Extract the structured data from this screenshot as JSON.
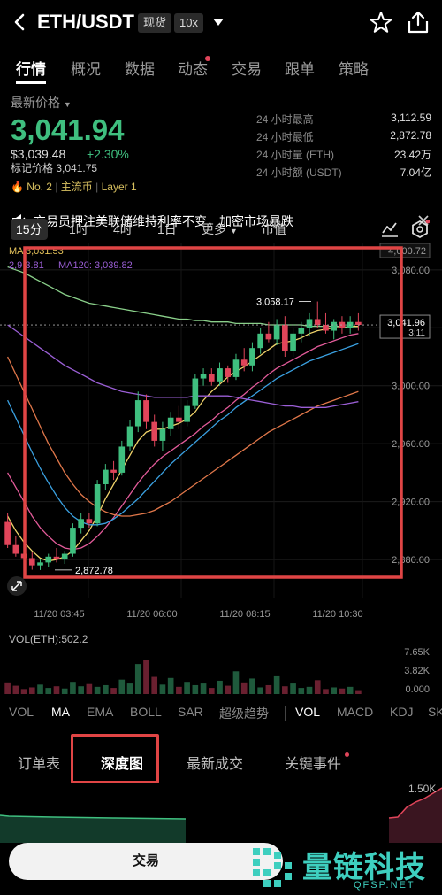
{
  "header": {
    "pair": "ETH/USDT",
    "badge_spot": "现货",
    "badge_leverage": "10x"
  },
  "tabs": [
    "行情",
    "概况",
    "数据",
    "动态",
    "交易",
    "跟单",
    "策略"
  ],
  "price": {
    "label": "最新价格",
    "last": "3,041.94",
    "usd": "$3,039.48",
    "change": "+2.30%",
    "mark": "标记价格 3,041.75",
    "rank": "No. 2",
    "category1": "主流币",
    "category2": "Layer 1"
  },
  "stats": [
    {
      "label": "24 小时最高",
      "value": "3,112.59"
    },
    {
      "label": "24 小时最低",
      "value": "2,872.78"
    },
    {
      "label": "24 小时量 (ETH)",
      "value": "23.42万"
    },
    {
      "label": "24 小时额 (USDT)",
      "value": "7.04亿"
    }
  ],
  "news": {
    "text": "交易员押注美联储维持利率不变，加密市场暴跌"
  },
  "intervals": {
    "items": [
      "15分",
      "1时",
      "4时",
      "1日",
      "更多",
      "市值"
    ]
  },
  "chart_data": {
    "type": "candlestick",
    "ma_legend": {
      "ma_top": "MA",
      "ma_top_values": "3,031.53",
      "ma120_label": "MA120: 3,039.82",
      "ma_prefix": "2,9",
      "ma_prefix_tail": "3.81"
    },
    "x_tick_labels": [
      "11/20 03:45",
      "11/20 06:00",
      "11/20 08:15",
      "11/20 10:30"
    ],
    "y_tick_labels": [
      "3,080.00",
      "3,040.00",
      "3,000.00",
      "2,960.00",
      "2,920.00",
      "2,880.00"
    ],
    "ylim": [
      2866,
      3086
    ],
    "y_ticks": [
      3080,
      3040,
      3000,
      2960,
      2920,
      2880
    ],
    "price_tag_top": "4,000.72",
    "current_price_tag": "3,041.96",
    "countdown": "3:11",
    "current_price": 3041.96,
    "high_marker": "3,058.17",
    "low_marker": "2,872.78",
    "candles": [
      [
        2906,
        2912,
        2888,
        2890
      ],
      [
        2890,
        2896,
        2882,
        2884
      ],
      [
        2884,
        2888,
        2878,
        2881
      ],
      [
        2881,
        2885,
        2873,
        2876
      ],
      [
        2876,
        2880,
        2872.78,
        2878
      ],
      [
        2878,
        2884,
        2875,
        2882
      ],
      [
        2882,
        2888,
        2878,
        2880
      ],
      [
        2880,
        2886,
        2877,
        2884
      ],
      [
        2884,
        2905,
        2882,
        2902
      ],
      [
        2902,
        2912,
        2898,
        2908
      ],
      [
        2908,
        2912,
        2902,
        2905
      ],
      [
        2905,
        2935,
        2903,
        2932
      ],
      [
        2932,
        2946,
        2928,
        2942
      ],
      [
        2942,
        2948,
        2935,
        2940
      ],
      [
        2940,
        2962,
        2938,
        2958
      ],
      [
        2958,
        2976,
        2955,
        2972
      ],
      [
        2972,
        2996,
        2968,
        2990
      ],
      [
        2990,
        2994,
        2970,
        2975
      ],
      [
        2975,
        2980,
        2958,
        2962
      ],
      [
        2962,
        2975,
        2955,
        2970
      ],
      [
        2970,
        2982,
        2965,
        2978
      ],
      [
        2978,
        2986,
        2970,
        2975
      ],
      [
        2975,
        2990,
        2972,
        2986
      ],
      [
        2986,
        3008,
        2984,
        3005
      ],
      [
        3005,
        3012,
        3000,
        3008
      ],
      [
        3008,
        3012,
        3000,
        3003
      ],
      [
        3003,
        3016,
        3000,
        3012
      ],
      [
        3012,
        3014,
        3002,
        3006
      ],
      [
        3006,
        3022,
        3004,
        3018
      ],
      [
        3018,
        3026,
        3010,
        3014
      ],
      [
        3014,
        3030,
        3010,
        3026
      ],
      [
        3026,
        3040,
        3022,
        3036
      ],
      [
        3036,
        3044,
        3030,
        3032
      ],
      [
        3032,
        3046,
        3028,
        3042
      ],
      [
        3042,
        3048,
        3020,
        3024
      ],
      [
        3024,
        3040,
        3020,
        3036
      ],
      [
        3036,
        3044,
        3030,
        3040
      ],
      [
        3040,
        3050,
        3034,
        3046
      ],
      [
        3046,
        3058.17,
        3040,
        3042
      ],
      [
        3042,
        3050,
        3036,
        3038
      ],
      [
        3038,
        3046,
        3032,
        3044
      ],
      [
        3044,
        3048,
        3036,
        3040
      ],
      [
        3040,
        3048,
        3036,
        3044
      ],
      [
        3044,
        3050,
        3038,
        3042
      ]
    ],
    "ma_lines": [
      {
        "color": "#f0d36a",
        "values": [
          2910,
          2900,
          2892,
          2886,
          2881,
          2879,
          2880,
          2882,
          2886,
          2893,
          2900,
          2910,
          2922,
          2932,
          2942,
          2952,
          2962,
          2968,
          2970,
          2970,
          2972,
          2974,
          2977,
          2982,
          2990,
          2996,
          3001,
          3006,
          3010,
          3013,
          3017,
          3021,
          3025,
          3029,
          3030,
          3031,
          3033,
          3036,
          3038,
          3039,
          3040,
          3040,
          3041,
          3041
        ]
      },
      {
        "color": "#e35b9a",
        "values": [
          2940,
          2930,
          2920,
          2910,
          2902,
          2896,
          2891,
          2888,
          2887,
          2888,
          2891,
          2896,
          2902,
          2909,
          2917,
          2925,
          2933,
          2940,
          2946,
          2951,
          2955,
          2959,
          2963,
          2967,
          2972,
          2976,
          2981,
          2985,
          2990,
          2994,
          2999,
          3003,
          3008,
          3012,
          3015,
          3018,
          3021,
          3024,
          3027,
          3029,
          3031,
          3033,
          3035,
          3036
        ]
      },
      {
        "color": "#3aa0e0",
        "values": [
          2990,
          2978,
          2966,
          2954,
          2943,
          2933,
          2924,
          2916,
          2910,
          2906,
          2904,
          2904,
          2905,
          2908,
          2912,
          2917,
          2922,
          2928,
          2934,
          2940,
          2946,
          2951,
          2956,
          2961,
          2966,
          2971,
          2976,
          2980,
          2985,
          2989,
          2993,
          2997,
          3001,
          3005,
          3008,
          3011,
          3014,
          3017,
          3019,
          3021,
          3023,
          3025,
          3027,
          3029
        ]
      },
      {
        "color": "#e0774a",
        "values": [
          3020,
          3008,
          2996,
          2984,
          2972,
          2960,
          2950,
          2940,
          2932,
          2925,
          2920,
          2916,
          2913,
          2911,
          2910,
          2910,
          2911,
          2912,
          2914,
          2917,
          2920,
          2924,
          2928,
          2932,
          2936,
          2940,
          2944,
          2948,
          2952,
          2956,
          2960,
          2964,
          2968,
          2971,
          2974,
          2977,
          2980,
          2983,
          2986,
          2988,
          2990,
          2992,
          2994,
          2996
        ]
      },
      {
        "color": "#9b5fd6",
        "values": [
          3042,
          3038,
          3034,
          3030,
          3026,
          3022,
          3018,
          3014,
          3011,
          3008,
          3005,
          3002,
          3000,
          2998,
          2996,
          2995,
          2994,
          2993,
          2992,
          2992,
          2992,
          2992,
          2992,
          2993,
          2993,
          2993,
          2993,
          2993,
          2992,
          2991,
          2990,
          2989,
          2988,
          2987,
          2986,
          2986,
          2985,
          2985,
          2985,
          2985,
          2986,
          2987,
          2988,
          2989
        ]
      },
      {
        "color": "#8ad08a",
        "values": [
          3082,
          3080,
          3078,
          3075,
          3072,
          3069,
          3066,
          3063,
          3061,
          3059,
          3057,
          3056,
          3055,
          3054,
          3053,
          3052,
          3051,
          3050,
          3049,
          3048,
          3047,
          3046,
          3046,
          3045,
          3045,
          3044,
          3044,
          3044,
          3043,
          3043,
          3043,
          3043,
          3042,
          3042,
          3042,
          3042,
          3042,
          3041,
          3041,
          3041,
          3041,
          3041,
          3040,
          3040
        ]
      }
    ],
    "volume_label": "VOL(ETH):502.2",
    "volume_ticks": [
      "7.65K",
      "3.82K",
      "0.000"
    ],
    "volume_max": 7650,
    "volume": [
      2100,
      1500,
      900,
      1200,
      1700,
      1100,
      1400,
      1000,
      2200,
      1400,
      1800,
      1300,
      1600,
      1100,
      2600,
      1900,
      5400,
      6200,
      3100,
      1700,
      2900,
      1300,
      2200,
      1600,
      1900,
      1100,
      2400,
      1500,
      4100,
      2100,
      2800,
      1200,
      1600,
      3200,
      1400,
      1900,
      1100,
      1300,
      2500,
      900,
      1200,
      1000,
      1300,
      700
    ]
  },
  "indicators": {
    "main": [
      "VOL",
      "MA",
      "EMA",
      "BOLL",
      "SAR",
      "超级趋势"
    ],
    "sub": [
      "VOL",
      "MACD",
      "KDJ",
      "SK"
    ]
  },
  "subtabs": [
    "订单表",
    "深度图",
    "最新成交",
    "关键事件"
  ],
  "depth": {
    "label": "1.50K"
  },
  "trade": {
    "button": "交易"
  },
  "watermark": {
    "text": "量链科技",
    "sub": "QFSP.NET"
  },
  "colors": {
    "up": "#3fbf7f",
    "down": "#e0455a",
    "highlight": "#e04545"
  }
}
